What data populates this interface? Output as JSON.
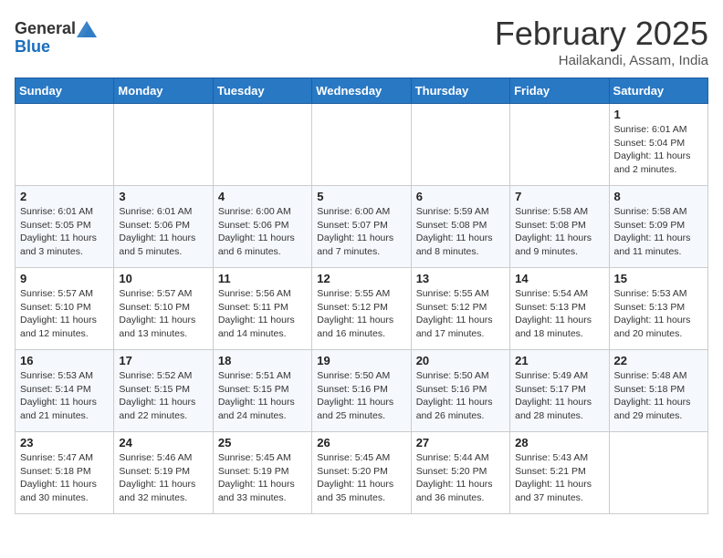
{
  "header": {
    "logo_general": "General",
    "logo_blue": "Blue",
    "title": "February 2025",
    "location": "Hailakandi, Assam, India"
  },
  "weekdays": [
    "Sunday",
    "Monday",
    "Tuesday",
    "Wednesday",
    "Thursday",
    "Friday",
    "Saturday"
  ],
  "weeks": [
    [
      {
        "day": "",
        "info": ""
      },
      {
        "day": "",
        "info": ""
      },
      {
        "day": "",
        "info": ""
      },
      {
        "day": "",
        "info": ""
      },
      {
        "day": "",
        "info": ""
      },
      {
        "day": "",
        "info": ""
      },
      {
        "day": "1",
        "info": "Sunrise: 6:01 AM\nSunset: 5:04 PM\nDaylight: 11 hours\nand 2 minutes."
      }
    ],
    [
      {
        "day": "2",
        "info": "Sunrise: 6:01 AM\nSunset: 5:05 PM\nDaylight: 11 hours\nand 3 minutes."
      },
      {
        "day": "3",
        "info": "Sunrise: 6:01 AM\nSunset: 5:06 PM\nDaylight: 11 hours\nand 5 minutes."
      },
      {
        "day": "4",
        "info": "Sunrise: 6:00 AM\nSunset: 5:06 PM\nDaylight: 11 hours\nand 6 minutes."
      },
      {
        "day": "5",
        "info": "Sunrise: 6:00 AM\nSunset: 5:07 PM\nDaylight: 11 hours\nand 7 minutes."
      },
      {
        "day": "6",
        "info": "Sunrise: 5:59 AM\nSunset: 5:08 PM\nDaylight: 11 hours\nand 8 minutes."
      },
      {
        "day": "7",
        "info": "Sunrise: 5:58 AM\nSunset: 5:08 PM\nDaylight: 11 hours\nand 9 minutes."
      },
      {
        "day": "8",
        "info": "Sunrise: 5:58 AM\nSunset: 5:09 PM\nDaylight: 11 hours\nand 11 minutes."
      }
    ],
    [
      {
        "day": "9",
        "info": "Sunrise: 5:57 AM\nSunset: 5:10 PM\nDaylight: 11 hours\nand 12 minutes."
      },
      {
        "day": "10",
        "info": "Sunrise: 5:57 AM\nSunset: 5:10 PM\nDaylight: 11 hours\nand 13 minutes."
      },
      {
        "day": "11",
        "info": "Sunrise: 5:56 AM\nSunset: 5:11 PM\nDaylight: 11 hours\nand 14 minutes."
      },
      {
        "day": "12",
        "info": "Sunrise: 5:55 AM\nSunset: 5:12 PM\nDaylight: 11 hours\nand 16 minutes."
      },
      {
        "day": "13",
        "info": "Sunrise: 5:55 AM\nSunset: 5:12 PM\nDaylight: 11 hours\nand 17 minutes."
      },
      {
        "day": "14",
        "info": "Sunrise: 5:54 AM\nSunset: 5:13 PM\nDaylight: 11 hours\nand 18 minutes."
      },
      {
        "day": "15",
        "info": "Sunrise: 5:53 AM\nSunset: 5:13 PM\nDaylight: 11 hours\nand 20 minutes."
      }
    ],
    [
      {
        "day": "16",
        "info": "Sunrise: 5:53 AM\nSunset: 5:14 PM\nDaylight: 11 hours\nand 21 minutes."
      },
      {
        "day": "17",
        "info": "Sunrise: 5:52 AM\nSunset: 5:15 PM\nDaylight: 11 hours\nand 22 minutes."
      },
      {
        "day": "18",
        "info": "Sunrise: 5:51 AM\nSunset: 5:15 PM\nDaylight: 11 hours\nand 24 minutes."
      },
      {
        "day": "19",
        "info": "Sunrise: 5:50 AM\nSunset: 5:16 PM\nDaylight: 11 hours\nand 25 minutes."
      },
      {
        "day": "20",
        "info": "Sunrise: 5:50 AM\nSunset: 5:16 PM\nDaylight: 11 hours\nand 26 minutes."
      },
      {
        "day": "21",
        "info": "Sunrise: 5:49 AM\nSunset: 5:17 PM\nDaylight: 11 hours\nand 28 minutes."
      },
      {
        "day": "22",
        "info": "Sunrise: 5:48 AM\nSunset: 5:18 PM\nDaylight: 11 hours\nand 29 minutes."
      }
    ],
    [
      {
        "day": "23",
        "info": "Sunrise: 5:47 AM\nSunset: 5:18 PM\nDaylight: 11 hours\nand 30 minutes."
      },
      {
        "day": "24",
        "info": "Sunrise: 5:46 AM\nSunset: 5:19 PM\nDaylight: 11 hours\nand 32 minutes."
      },
      {
        "day": "25",
        "info": "Sunrise: 5:45 AM\nSunset: 5:19 PM\nDaylight: 11 hours\nand 33 minutes."
      },
      {
        "day": "26",
        "info": "Sunrise: 5:45 AM\nSunset: 5:20 PM\nDaylight: 11 hours\nand 35 minutes."
      },
      {
        "day": "27",
        "info": "Sunrise: 5:44 AM\nSunset: 5:20 PM\nDaylight: 11 hours\nand 36 minutes."
      },
      {
        "day": "28",
        "info": "Sunrise: 5:43 AM\nSunset: 5:21 PM\nDaylight: 11 hours\nand 37 minutes."
      },
      {
        "day": "",
        "info": ""
      }
    ]
  ]
}
